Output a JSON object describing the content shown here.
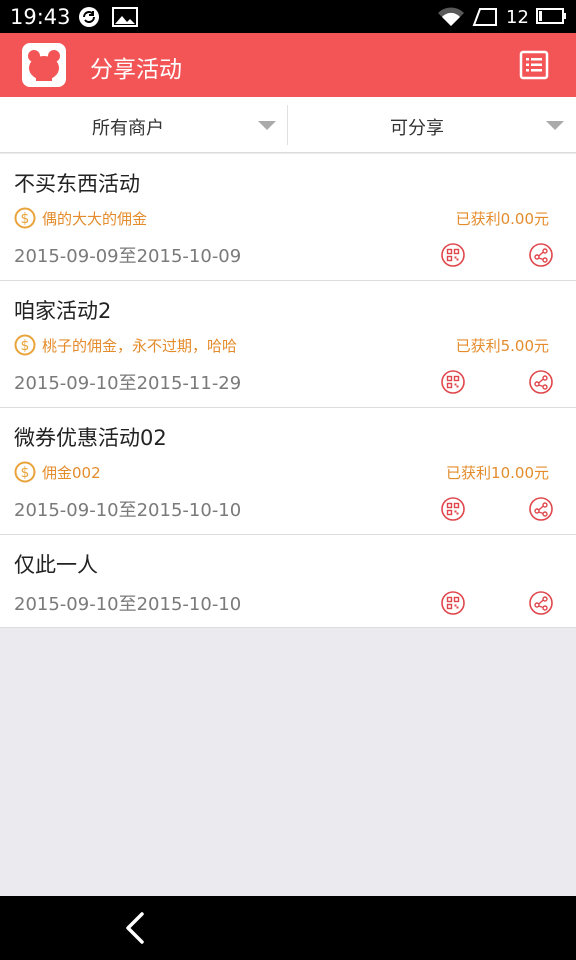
{
  "status_bar": {
    "time": "19:43",
    "battery_level": "12"
  },
  "app_bar": {
    "title": "分享活动",
    "logo": "mascot-logo",
    "menu_icon": "list-icon"
  },
  "filters": [
    {
      "label": "所有商户"
    },
    {
      "label": "可分享"
    }
  ],
  "activities": [
    {
      "title": "不买东西活动",
      "commission": "偶的大大的佣金",
      "earned": "已获利0.00元",
      "dates": "2015-09-09至2015-10-09"
    },
    {
      "title": "咱家活动2",
      "commission": "桃子的佣金，永不过期，哈哈",
      "earned": "已获利5.00元",
      "dates": "2015-09-10至2015-11-29"
    },
    {
      "title": "微券优惠活动02",
      "commission": "佣金002",
      "earned": "已获利10.00元",
      "dates": "2015-09-10至2015-10-10"
    },
    {
      "title": "仅此一人",
      "dates": "2015-09-10至2015-10-10"
    }
  ],
  "colors": {
    "brand": "#f35557",
    "commission": "#e48c2c",
    "icon_red": "#e0474c"
  }
}
